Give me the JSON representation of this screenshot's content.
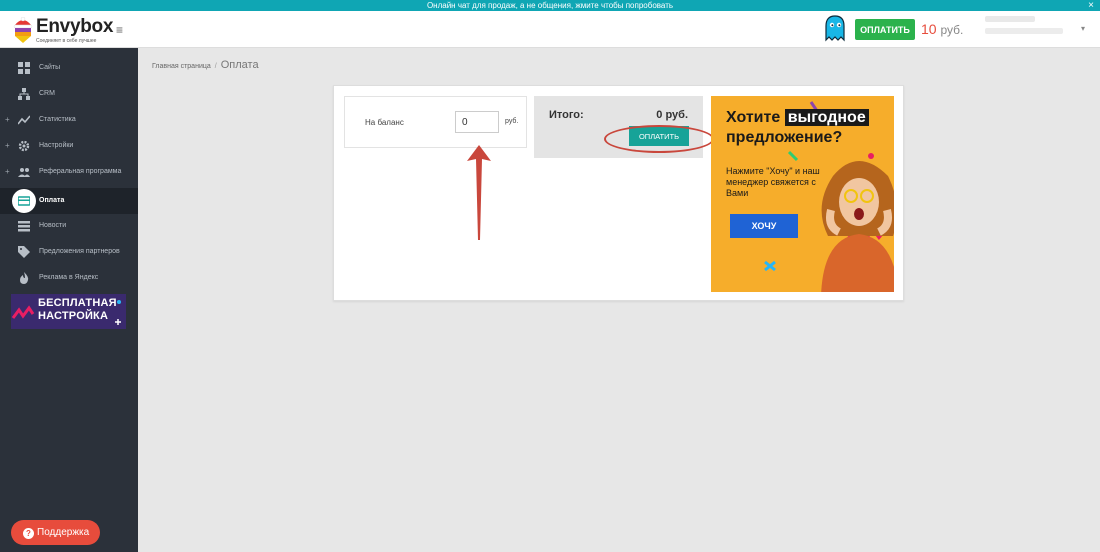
{
  "banner": {
    "text": "Онлайн чат для продаж, а не общения, жмите чтобы попробовать",
    "close": "×"
  },
  "header": {
    "logo_name": "Envybox",
    "logo_tagline": "Соединяет в себе лучшее",
    "menu_icon": "hamburger-icon",
    "pay_label": "ОПЛАТИТЬ",
    "balance_value": "10",
    "balance_unit": "руб."
  },
  "sidebar": {
    "items": [
      {
        "label": "Сайты",
        "icon": "grid-icon",
        "expandable": false
      },
      {
        "label": "CRM",
        "icon": "sitemap-icon",
        "expandable": false
      },
      {
        "label": "Статистика",
        "icon": "chart-line-icon",
        "expandable": true
      },
      {
        "label": "Настройки",
        "icon": "gear-icon",
        "expandable": true
      },
      {
        "label": "Реферальная программа",
        "icon": "users-icon",
        "expandable": true
      },
      {
        "label": "Оплата",
        "icon": "card-icon",
        "expandable": false,
        "active": true
      },
      {
        "label": "Новости",
        "icon": "list-icon",
        "expandable": false
      },
      {
        "label": "Предложения партнеров",
        "icon": "tag-icon",
        "expandable": false
      },
      {
        "label": "Реклама в Яндекс",
        "icon": "fire-icon",
        "expandable": false
      }
    ],
    "promo_line1": "БЕСПЛАТНАЯ",
    "promo_line2": "НАСТРОЙКА",
    "support_label": "Поддержка"
  },
  "breadcrumb": {
    "home": "Главная страница",
    "separator": "/",
    "current": "Оплата"
  },
  "payment": {
    "balance_label": "На баланс",
    "balance_input": "0",
    "balance_unit": "руб.",
    "total_label": "Итого:",
    "total_value": "0 руб.",
    "pay_label": "ОПЛАТИТЬ"
  },
  "ad": {
    "line1_pre": "Хотите",
    "line1_hl": "выгодное",
    "line2": "предложение?",
    "sub": "Нажмите \"Хочу\" и наш менеджер свяжется с Вами",
    "button": "ХОЧУ"
  },
  "colors": {
    "banner": "#0fa6b4",
    "sidebar": "#2b313a",
    "pay_green": "#2bb24c",
    "pay_teal": "#17a398",
    "balance_red": "#e74c3c",
    "annotation_red": "#c9473c",
    "ad_orange": "#f6ad2b",
    "ad_button_blue": "#1f63d5"
  }
}
